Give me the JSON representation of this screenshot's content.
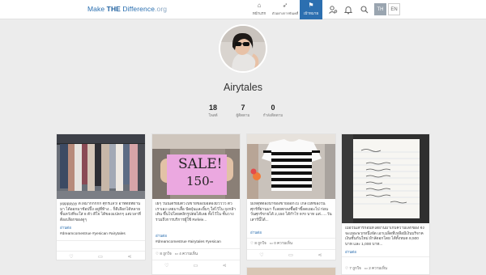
{
  "header": {
    "logo": {
      "make": "Make ",
      "the": "THE",
      "difference": " Difference",
      "domain": ".org"
    },
    "nav": [
      {
        "label": "หน้าแรก",
        "icon": "home-icon"
      },
      {
        "label": "ตัวอย่างการขับเคลื่อน",
        "icon": "rocket-icon"
      },
      {
        "label": "เป้าหมาย",
        "icon": "target-icon"
      }
    ],
    "languages": {
      "th": "TH",
      "en": "EN"
    }
  },
  "profile": {
    "username": "Airytales",
    "stats": [
      {
        "value": "18",
        "label": "โพสต์"
      },
      {
        "value": "7",
        "label": "ผู้ติดตาม"
      },
      {
        "value": "0",
        "label": "กำลังติดตาม"
      }
    ]
  },
  "cards": [
    {
      "caption": "yippppyyy ดีใจมากกกกก ศุกร์แล้ว! อาทิตย์ที่ผ่านมา ได้ออกมาช้อปปิ้ง อยู่ที่ท้าง... ก็ดีเลือกได้หลายชิ้นหวังที่จะใส่ 8 ตัว ดีใจ ได้ของแปลกๆ แต่เวลาที่ต้องเลือกของดูๆ",
      "more": "อ่านต่อ",
      "tags": "#dreamcomestrue #yesican #airytales",
      "likes": "",
      "comments": ""
    },
    {
      "caption": "เย่ๆ วันนี้เตรียมตัวไปขายของมือสองมัวววว ตัวเราเอง เลยมาเสื้อ ปัดฝุ่นและยิ้มๆ ใส่ไว้ใน ถุงกล้าเดิน ขึ้นไปโดยคลิกรูปต่อได้เลย ทั้งไว้ใน ชั้นวาง รวมถึงการบริการผู้ใช้ Refele...",
      "more": "อ่านต่อ",
      "tags": "#dreamcomestrue #airytales #yesican",
      "sign_text": "SALE!",
      "price_text": "150-",
      "likes": "8 ถูกใจ",
      "comments": "4 ความเห็น"
    },
    {
      "caption": "มีเหตุที่ต้องนำของขายออกไป ใกล้ไปที่ของวัน ศุกร์ที่ผ่านมา ก็เลยตกลงซื้อผ้าขี้ลดเยอะไป ก่อน วันศุกร์ขายได้ 2,150 ได้กำไร 970 บาท แต่......วันเสาร์นี้ได้...",
      "more": "อ่านต่อ",
      "tags": "",
      "likes": "8 ถูกใจ",
      "comments": "0 ความเห็น"
    },
    {
      "caption": "เมื่อวันเสาร์ก่อนที่ได้ผ่านมาเก็บความเล็กของ จึงจะเยอะพวกหนึ่งจัด เอาเมล็ดที่เหลือมีเงินบริจาคเงินชั้นกันใหม่ ผ้าลัดอกโดย ได้ทั้งหมด 8,500 บาท และ 1,000 บาท...",
      "more": "อ่านต่อ",
      "tags": "",
      "likes": "7 ถูกใจ",
      "comments": "2 ความเห็น"
    }
  ],
  "colors": {
    "accent": "#2c6fb0",
    "background": "#ececec"
  }
}
